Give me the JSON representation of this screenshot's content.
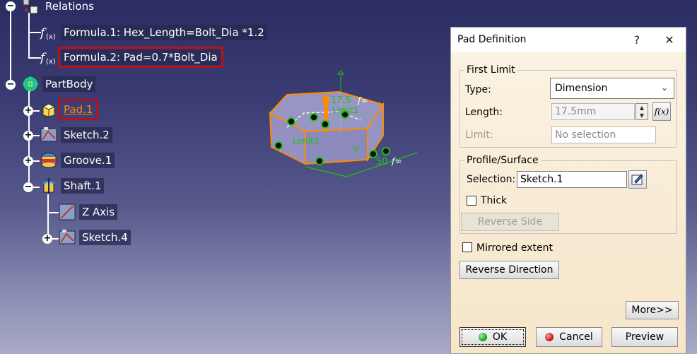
{
  "tree": {
    "relations": {
      "label": "Relations",
      "icon": "relations-icon"
    },
    "formula1": {
      "label": "Formula.1: Hex_Length=Bolt_Dia *1.2",
      "icon": "formula-icon"
    },
    "formula2": {
      "label": "Formula.2: Pad=0.7*Bolt_Dia",
      "icon": "formula-icon"
    },
    "partbody": {
      "label": "PartBody",
      "icon": "partbody-icon"
    },
    "pad1": {
      "label": "Pad.1",
      "icon": "pad-icon"
    },
    "sketch2": {
      "label": "Sketch.2",
      "icon": "sketch-icon"
    },
    "groove1": {
      "label": "Groove.1",
      "icon": "groove-icon"
    },
    "shaft1": {
      "label": "Shaft.1",
      "icon": "shaft-icon"
    },
    "zaxis": {
      "label": "Z Axis",
      "icon": "axis-icon"
    },
    "sketch4": {
      "label": "Sketch.4",
      "icon": "sketch-icon"
    }
  },
  "viewport": {
    "dim_length": "17.5",
    "limit1": "Limit1",
    "limit2": "Limit2",
    "dim_width": "50"
  },
  "dialog": {
    "title": "Pad Definition",
    "help_button": "?",
    "close_button": "✕",
    "first_limit": {
      "legend": "First Limit",
      "type_label": "Type:",
      "type_value": "Dimension",
      "length_label": "Length:",
      "length_value": "17.5mm",
      "formula_button": "f(x)",
      "limit_label": "Limit:",
      "limit_value": "No selection"
    },
    "profile": {
      "legend": "Profile/Surface",
      "selection_label": "Selection:",
      "selection_value": "Sketch.1",
      "thick_label": "Thick",
      "reverse_side": "Reverse Side"
    },
    "mirrored_label": "Mirrored extent",
    "reverse_direction": "Reverse Direction",
    "more_button": "More>>",
    "ok_button": "OK",
    "cancel_button": "Cancel",
    "preview_button": "Preview"
  },
  "colors": {
    "highlight_frame": "#b5121b",
    "selected_text": "#ff8a00",
    "geometry_edge": "#ff8a00",
    "dimension": "#22c01a",
    "dialog_bg": "#f6e6c9"
  }
}
